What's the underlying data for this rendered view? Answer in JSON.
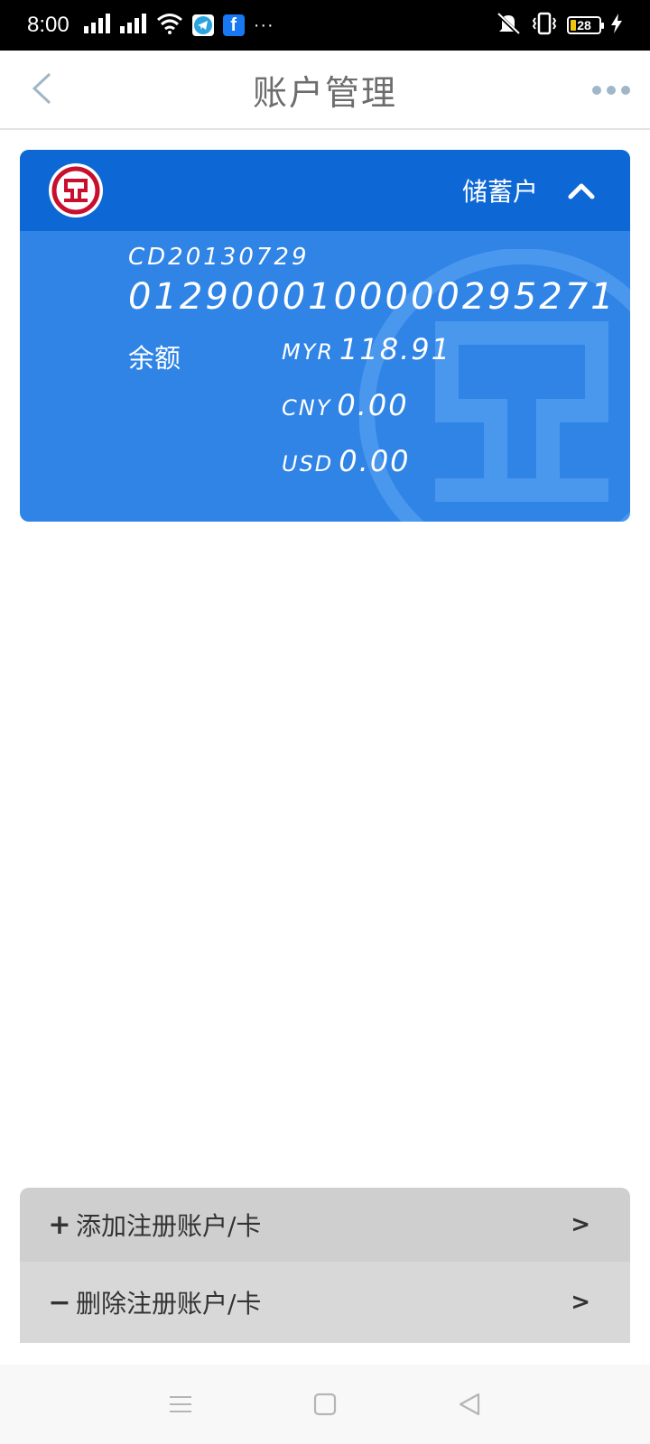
{
  "status_bar": {
    "time": "8:00",
    "dots": "···",
    "battery_level": "28",
    "icons": [
      "signal-icon",
      "signal-icon",
      "wifi-icon",
      "telegram-icon",
      "facebook-icon",
      "more-notifications-icon",
      "mute-vibrate-icon",
      "vibrate-icon",
      "battery-icon",
      "charging-icon"
    ]
  },
  "header": {
    "title": "账户管理",
    "back_icon": "chevron-left-icon",
    "more_icon": "more-dots-icon"
  },
  "account_card": {
    "account_type": "储蓄户",
    "code": "CD20130729",
    "account_number": "0129000100000295271",
    "balance_label": "余额",
    "balances": [
      {
        "currency": "MYR",
        "amount": "118.91"
      },
      {
        "currency": "CNY",
        "amount": "0.00"
      },
      {
        "currency": "USD",
        "amount": "0.00"
      }
    ],
    "colors": {
      "header": "#0d68d6",
      "body": "#2f84e6",
      "logo_red": "#c8102e"
    }
  },
  "actions": {
    "add": {
      "sign": "+",
      "label": "添加注册账户/卡",
      "chevron": ">"
    },
    "remove": {
      "sign": "−",
      "label": "删除注册账户/卡",
      "chevron": ">"
    }
  },
  "system_nav": {
    "icons": [
      "menu-icon",
      "home-square-icon",
      "back-triangle-icon"
    ]
  }
}
